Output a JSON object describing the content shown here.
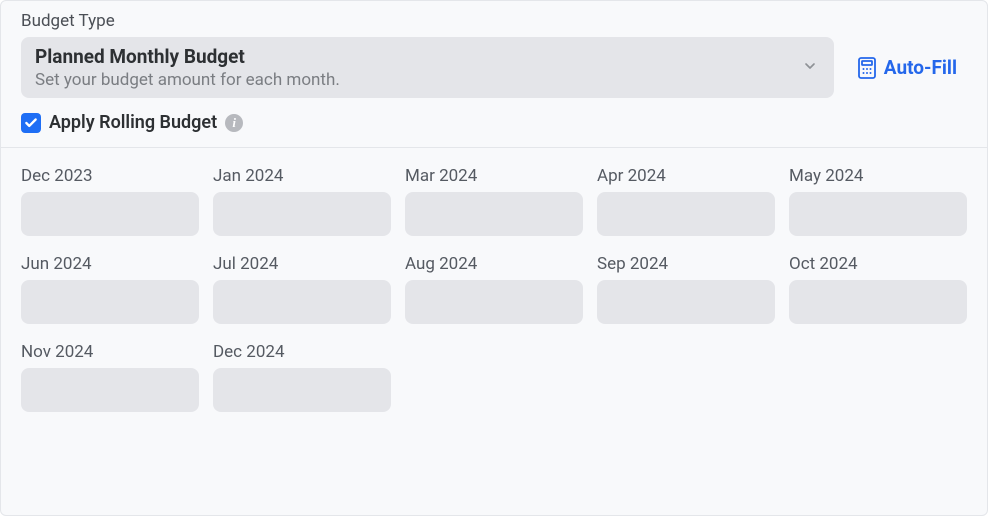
{
  "colors": {
    "accent": "#2467eb",
    "checkbox": "#1e6ef5"
  },
  "header": {
    "section_label": "Budget Type",
    "select": {
      "title": "Planned Monthly Budget",
      "subtitle": "Set your budget amount for each month."
    },
    "auto_fill_label": "Auto-Fill",
    "checkbox": {
      "checked": true,
      "label": "Apply Rolling Budget"
    },
    "info_tooltip": "i"
  },
  "months": [
    {
      "label": "Dec 2023",
      "value": ""
    },
    {
      "label": "Jan 2024",
      "value": ""
    },
    {
      "label": "Mar 2024",
      "value": ""
    },
    {
      "label": "Apr 2024",
      "value": ""
    },
    {
      "label": "May 2024",
      "value": ""
    },
    {
      "label": "Jun 2024",
      "value": ""
    },
    {
      "label": "Jul 2024",
      "value": ""
    },
    {
      "label": "Aug 2024",
      "value": ""
    },
    {
      "label": "Sep 2024",
      "value": ""
    },
    {
      "label": "Oct 2024",
      "value": ""
    },
    {
      "label": "Nov 2024",
      "value": ""
    },
    {
      "label": "Dec 2024",
      "value": ""
    }
  ]
}
